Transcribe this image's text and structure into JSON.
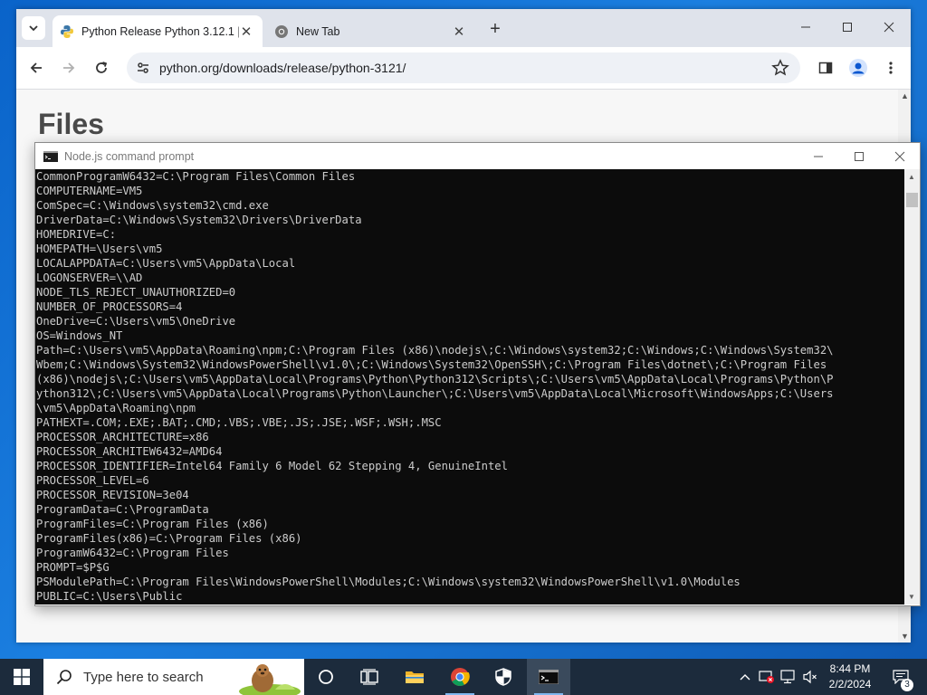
{
  "browser": {
    "tabs": [
      {
        "title": "Python Release Python 3.12.1 |",
        "active": true,
        "favicon": "python-favicon"
      },
      {
        "title": "New Tab",
        "active": false,
        "favicon": "chrome-favicon"
      }
    ],
    "new_tab_symbol": "+",
    "close_symbol": "✕",
    "url": "python.org/downloads/release/python-3121/",
    "page_heading": "Files"
  },
  "cmd": {
    "title": "Node.js command prompt",
    "lines": [
      "CommonProgramW6432=C:\\Program Files\\Common Files",
      "COMPUTERNAME=VM5",
      "ComSpec=C:\\Windows\\system32\\cmd.exe",
      "DriverData=C:\\Windows\\System32\\Drivers\\DriverData",
      "HOMEDRIVE=C:",
      "HOMEPATH=\\Users\\vm5",
      "LOCALAPPDATA=C:\\Users\\vm5\\AppData\\Local",
      "LOGONSERVER=\\\\AD",
      "NODE_TLS_REJECT_UNAUTHORIZED=0",
      "NUMBER_OF_PROCESSORS=4",
      "OneDrive=C:\\Users\\vm5\\OneDrive",
      "OS=Windows_NT",
      "Path=C:\\Users\\vm5\\AppData\\Roaming\\npm;C:\\Program Files (x86)\\nodejs\\;C:\\Windows\\system32;C:\\Windows;C:\\Windows\\System32\\",
      "Wbem;C:\\Windows\\System32\\WindowsPowerShell\\v1.0\\;C:\\Windows\\System32\\OpenSSH\\;C:\\Program Files\\dotnet\\;C:\\Program Files",
      "(x86)\\nodejs\\;C:\\Users\\vm5\\AppData\\Local\\Programs\\Python\\Python312\\Scripts\\;C:\\Users\\vm5\\AppData\\Local\\Programs\\Python\\P",
      "ython312\\;C:\\Users\\vm5\\AppData\\Local\\Programs\\Python\\Launcher\\;C:\\Users\\vm5\\AppData\\Local\\Microsoft\\WindowsApps;C:\\Users",
      "\\vm5\\AppData\\Roaming\\npm",
      "PATHEXT=.COM;.EXE;.BAT;.CMD;.VBS;.VBE;.JS;.JSE;.WSF;.WSH;.MSC",
      "PROCESSOR_ARCHITECTURE=x86",
      "PROCESSOR_ARCHITEW6432=AMD64",
      "PROCESSOR_IDENTIFIER=Intel64 Family 6 Model 62 Stepping 4, GenuineIntel",
      "PROCESSOR_LEVEL=6",
      "PROCESSOR_REVISION=3e04",
      "ProgramData=C:\\ProgramData",
      "ProgramFiles=C:\\Program Files (x86)",
      "ProgramFiles(x86)=C:\\Program Files (x86)",
      "ProgramW6432=C:\\Program Files",
      "PROMPT=$P$G",
      "PSModulePath=C:\\Program Files\\WindowsPowerShell\\Modules;C:\\Windows\\system32\\WindowsPowerShell\\v1.0\\Modules",
      "PUBLIC=C:\\Users\\Public"
    ]
  },
  "taskbar": {
    "search_placeholder": "Type here to search",
    "time": "8:44 PM",
    "date": "2/2/2024",
    "notification_count": "3",
    "apps": [
      "task-view",
      "file-explorer",
      "chrome",
      "security",
      "command-prompt"
    ]
  },
  "colors": {
    "console_bg": "#0c0c0c",
    "console_text": "#cccccc",
    "taskbar_bg": "#1c2b3c",
    "tabstrip_bg": "#dfe3eb",
    "omnibox_bg": "#eef1f6"
  }
}
